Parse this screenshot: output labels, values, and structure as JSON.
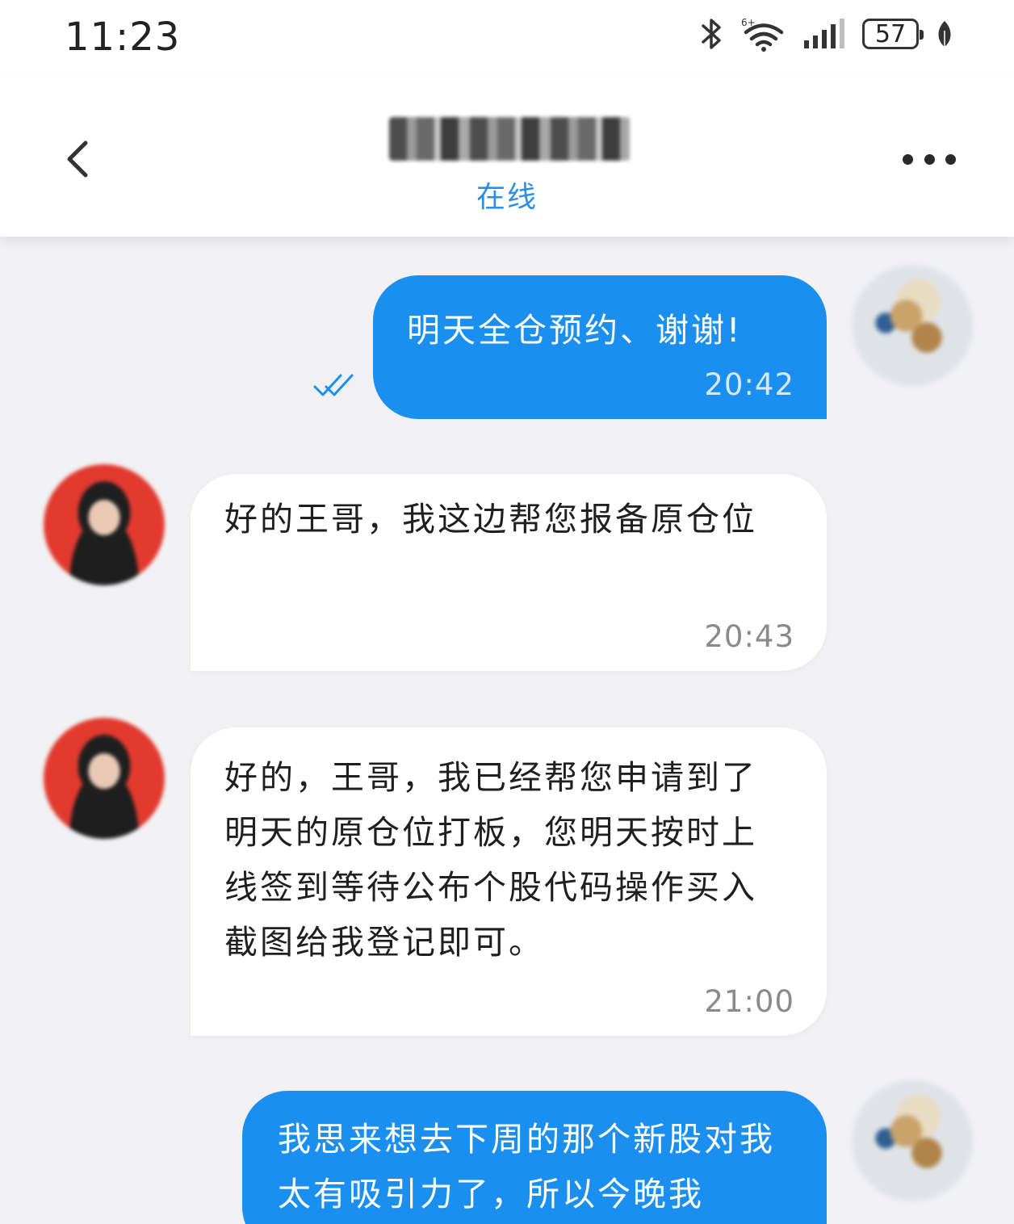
{
  "status_bar": {
    "time": "11:23",
    "battery": "57",
    "icons": [
      "bluetooth-icon",
      "wifi-icon",
      "signal-icon",
      "battery-icon",
      "leaf-icon"
    ]
  },
  "header": {
    "contact_name": "王哥",
    "status": "在线",
    "back_icon": "chevron-left-icon",
    "more_icon": "more-horizontal-icon"
  },
  "colors": {
    "accent": "#1b8ff0",
    "status_online": "#2c8fe6",
    "chat_background": "#f1f1f3",
    "incoming_bubble": "#ffffff"
  },
  "messages": [
    {
      "direction": "outgoing",
      "text": "明天全仓预约、谢谢!",
      "time": "20:42",
      "read": true
    },
    {
      "direction": "incoming",
      "text": "好的王哥，我这边帮您报备原仓位",
      "time": "20:43"
    },
    {
      "direction": "incoming",
      "text": "好的，王哥，我已经帮您申请到了明天的原仓位打板，您明天按时上线签到等待公布个股代码操作买入截图给我登记即可。",
      "time": "21:00"
    },
    {
      "direction": "outgoing",
      "text": "我思来想去下周的那个新股对我太有吸引力了，所以今晚我"
    }
  ]
}
